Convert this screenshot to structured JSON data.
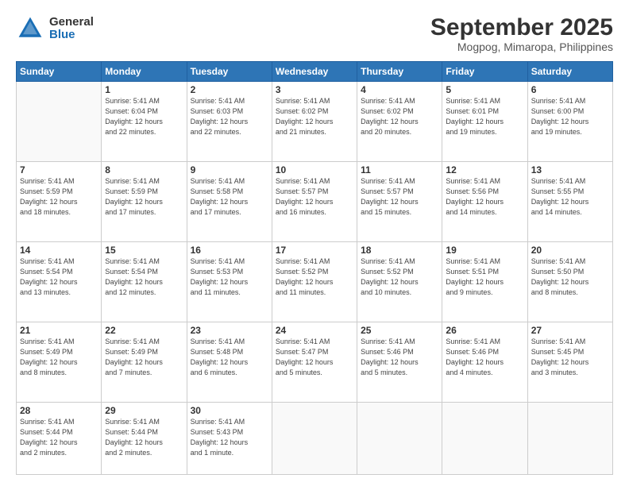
{
  "header": {
    "logo_general": "General",
    "logo_blue": "Blue",
    "title": "September 2025",
    "subtitle": "Mogpog, Mimaropa, Philippines"
  },
  "weekdays": [
    "Sunday",
    "Monday",
    "Tuesday",
    "Wednesday",
    "Thursday",
    "Friday",
    "Saturday"
  ],
  "weeks": [
    [
      {
        "day": "",
        "info": ""
      },
      {
        "day": "1",
        "info": "Sunrise: 5:41 AM\nSunset: 6:04 PM\nDaylight: 12 hours\nand 22 minutes."
      },
      {
        "day": "2",
        "info": "Sunrise: 5:41 AM\nSunset: 6:03 PM\nDaylight: 12 hours\nand 22 minutes."
      },
      {
        "day": "3",
        "info": "Sunrise: 5:41 AM\nSunset: 6:02 PM\nDaylight: 12 hours\nand 21 minutes."
      },
      {
        "day": "4",
        "info": "Sunrise: 5:41 AM\nSunset: 6:02 PM\nDaylight: 12 hours\nand 20 minutes."
      },
      {
        "day": "5",
        "info": "Sunrise: 5:41 AM\nSunset: 6:01 PM\nDaylight: 12 hours\nand 19 minutes."
      },
      {
        "day": "6",
        "info": "Sunrise: 5:41 AM\nSunset: 6:00 PM\nDaylight: 12 hours\nand 19 minutes."
      }
    ],
    [
      {
        "day": "7",
        "info": "Sunrise: 5:41 AM\nSunset: 5:59 PM\nDaylight: 12 hours\nand 18 minutes."
      },
      {
        "day": "8",
        "info": "Sunrise: 5:41 AM\nSunset: 5:59 PM\nDaylight: 12 hours\nand 17 minutes."
      },
      {
        "day": "9",
        "info": "Sunrise: 5:41 AM\nSunset: 5:58 PM\nDaylight: 12 hours\nand 17 minutes."
      },
      {
        "day": "10",
        "info": "Sunrise: 5:41 AM\nSunset: 5:57 PM\nDaylight: 12 hours\nand 16 minutes."
      },
      {
        "day": "11",
        "info": "Sunrise: 5:41 AM\nSunset: 5:57 PM\nDaylight: 12 hours\nand 15 minutes."
      },
      {
        "day": "12",
        "info": "Sunrise: 5:41 AM\nSunset: 5:56 PM\nDaylight: 12 hours\nand 14 minutes."
      },
      {
        "day": "13",
        "info": "Sunrise: 5:41 AM\nSunset: 5:55 PM\nDaylight: 12 hours\nand 14 minutes."
      }
    ],
    [
      {
        "day": "14",
        "info": "Sunrise: 5:41 AM\nSunset: 5:54 PM\nDaylight: 12 hours\nand 13 minutes."
      },
      {
        "day": "15",
        "info": "Sunrise: 5:41 AM\nSunset: 5:54 PM\nDaylight: 12 hours\nand 12 minutes."
      },
      {
        "day": "16",
        "info": "Sunrise: 5:41 AM\nSunset: 5:53 PM\nDaylight: 12 hours\nand 11 minutes."
      },
      {
        "day": "17",
        "info": "Sunrise: 5:41 AM\nSunset: 5:52 PM\nDaylight: 12 hours\nand 11 minutes."
      },
      {
        "day": "18",
        "info": "Sunrise: 5:41 AM\nSunset: 5:52 PM\nDaylight: 12 hours\nand 10 minutes."
      },
      {
        "day": "19",
        "info": "Sunrise: 5:41 AM\nSunset: 5:51 PM\nDaylight: 12 hours\nand 9 minutes."
      },
      {
        "day": "20",
        "info": "Sunrise: 5:41 AM\nSunset: 5:50 PM\nDaylight: 12 hours\nand 8 minutes."
      }
    ],
    [
      {
        "day": "21",
        "info": "Sunrise: 5:41 AM\nSunset: 5:49 PM\nDaylight: 12 hours\nand 8 minutes."
      },
      {
        "day": "22",
        "info": "Sunrise: 5:41 AM\nSunset: 5:49 PM\nDaylight: 12 hours\nand 7 minutes."
      },
      {
        "day": "23",
        "info": "Sunrise: 5:41 AM\nSunset: 5:48 PM\nDaylight: 12 hours\nand 6 minutes."
      },
      {
        "day": "24",
        "info": "Sunrise: 5:41 AM\nSunset: 5:47 PM\nDaylight: 12 hours\nand 5 minutes."
      },
      {
        "day": "25",
        "info": "Sunrise: 5:41 AM\nSunset: 5:46 PM\nDaylight: 12 hours\nand 5 minutes."
      },
      {
        "day": "26",
        "info": "Sunrise: 5:41 AM\nSunset: 5:46 PM\nDaylight: 12 hours\nand 4 minutes."
      },
      {
        "day": "27",
        "info": "Sunrise: 5:41 AM\nSunset: 5:45 PM\nDaylight: 12 hours\nand 3 minutes."
      }
    ],
    [
      {
        "day": "28",
        "info": "Sunrise: 5:41 AM\nSunset: 5:44 PM\nDaylight: 12 hours\nand 2 minutes."
      },
      {
        "day": "29",
        "info": "Sunrise: 5:41 AM\nSunset: 5:44 PM\nDaylight: 12 hours\nand 2 minutes."
      },
      {
        "day": "30",
        "info": "Sunrise: 5:41 AM\nSunset: 5:43 PM\nDaylight: 12 hours\nand 1 minute."
      },
      {
        "day": "",
        "info": ""
      },
      {
        "day": "",
        "info": ""
      },
      {
        "day": "",
        "info": ""
      },
      {
        "day": "",
        "info": ""
      }
    ]
  ]
}
